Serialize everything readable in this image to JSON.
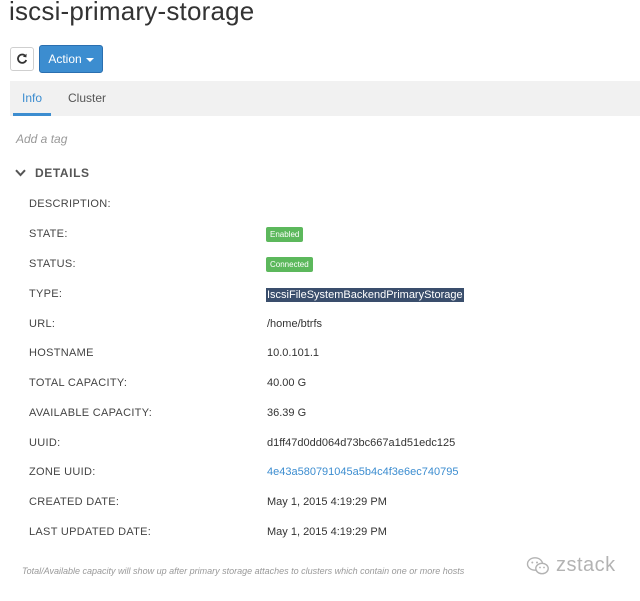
{
  "header": {
    "title": "iscsi-primary-storage"
  },
  "toolbar": {
    "refresh_icon": "refresh-icon",
    "action_label": "Action"
  },
  "tabs": [
    {
      "label": "Info",
      "active": true
    },
    {
      "label": "Cluster",
      "active": false
    }
  ],
  "tags": {
    "add_tag_label": "Add a tag"
  },
  "details": {
    "section_title": "DETAILS",
    "rows": [
      {
        "label": "DESCRIPTION:",
        "value": ""
      },
      {
        "label": "STATE:",
        "value": "Enabled"
      },
      {
        "label": "STATUS:",
        "value": "Connected"
      },
      {
        "label": "TYPE:",
        "value": "IscsiFileSystemBackendPrimaryStorage"
      },
      {
        "label": "URL:",
        "value": "/home/btrfs"
      },
      {
        "label": "HOSTNAME",
        "value": "10.0.101.1"
      },
      {
        "label": "TOTAL CAPACITY:",
        "value": "40.00 G"
      },
      {
        "label": "AVAILABLE CAPACITY:",
        "value": "36.39 G"
      },
      {
        "label": "UUID:",
        "value": "d1ff47d0dd064d73bc667a1d51edc125"
      },
      {
        "label": "ZONE UUID:",
        "value": "4e43a580791045a5b4c4f3e6ec740795"
      },
      {
        "label": "CREATED DATE:",
        "value": "May 1, 2015 4:19:29 PM"
      },
      {
        "label": "LAST UPDATED DATE:",
        "value": "May 1, 2015 4:19:29 PM"
      }
    ]
  },
  "footnote": "Total/Available capacity will show up after primary storage attaches to clusters which contain one or more hosts",
  "watermark": {
    "text": "zstack"
  },
  "colors": {
    "accent": "#3c8dd0",
    "badge_success": "#5cb85c",
    "selection": "#3a4e6c",
    "tab_bar": "#f1f1f1"
  }
}
